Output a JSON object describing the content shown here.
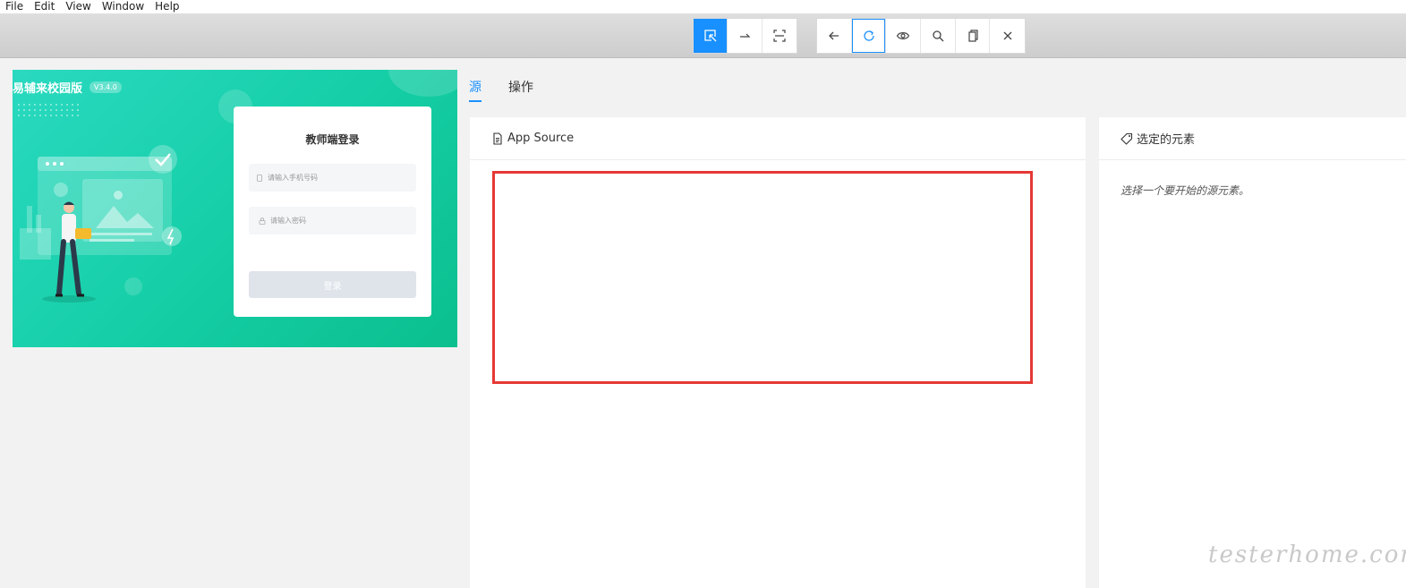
{
  "menu": [
    "File",
    "Edit",
    "View",
    "Window",
    "Help"
  ],
  "toolbar": {
    "group1": [
      {
        "icon": "select-element-icon",
        "active": true
      },
      {
        "icon": "swipe-arrow-icon"
      },
      {
        "icon": "screen-fit-icon"
      }
    ],
    "group2": [
      {
        "icon": "back-arrow-icon"
      },
      {
        "icon": "refresh-icon",
        "outlined": true
      },
      {
        "icon": "eye-icon"
      },
      {
        "icon": "search-icon"
      },
      {
        "icon": "copy-icon"
      },
      {
        "icon": "close-icon"
      }
    ]
  },
  "device": {
    "brand": "易辅来校园版",
    "version": "V3.4.0",
    "login_title": "教师端登录",
    "phone_placeholder": "请输入手机号码",
    "password_placeholder": "请输入密码",
    "login_button": "登录"
  },
  "tabs": [
    "源",
    "操作"
  ],
  "source_panel": {
    "title": "App Source"
  },
  "selected_panel": {
    "title": "选定的元素",
    "hint": "选择一个要开始的源元素。"
  },
  "watermark": "testerhome.com",
  "colors": {
    "accent": "#1890ff",
    "highlight": "#e53935",
    "device_bg": "#16cfa8"
  }
}
